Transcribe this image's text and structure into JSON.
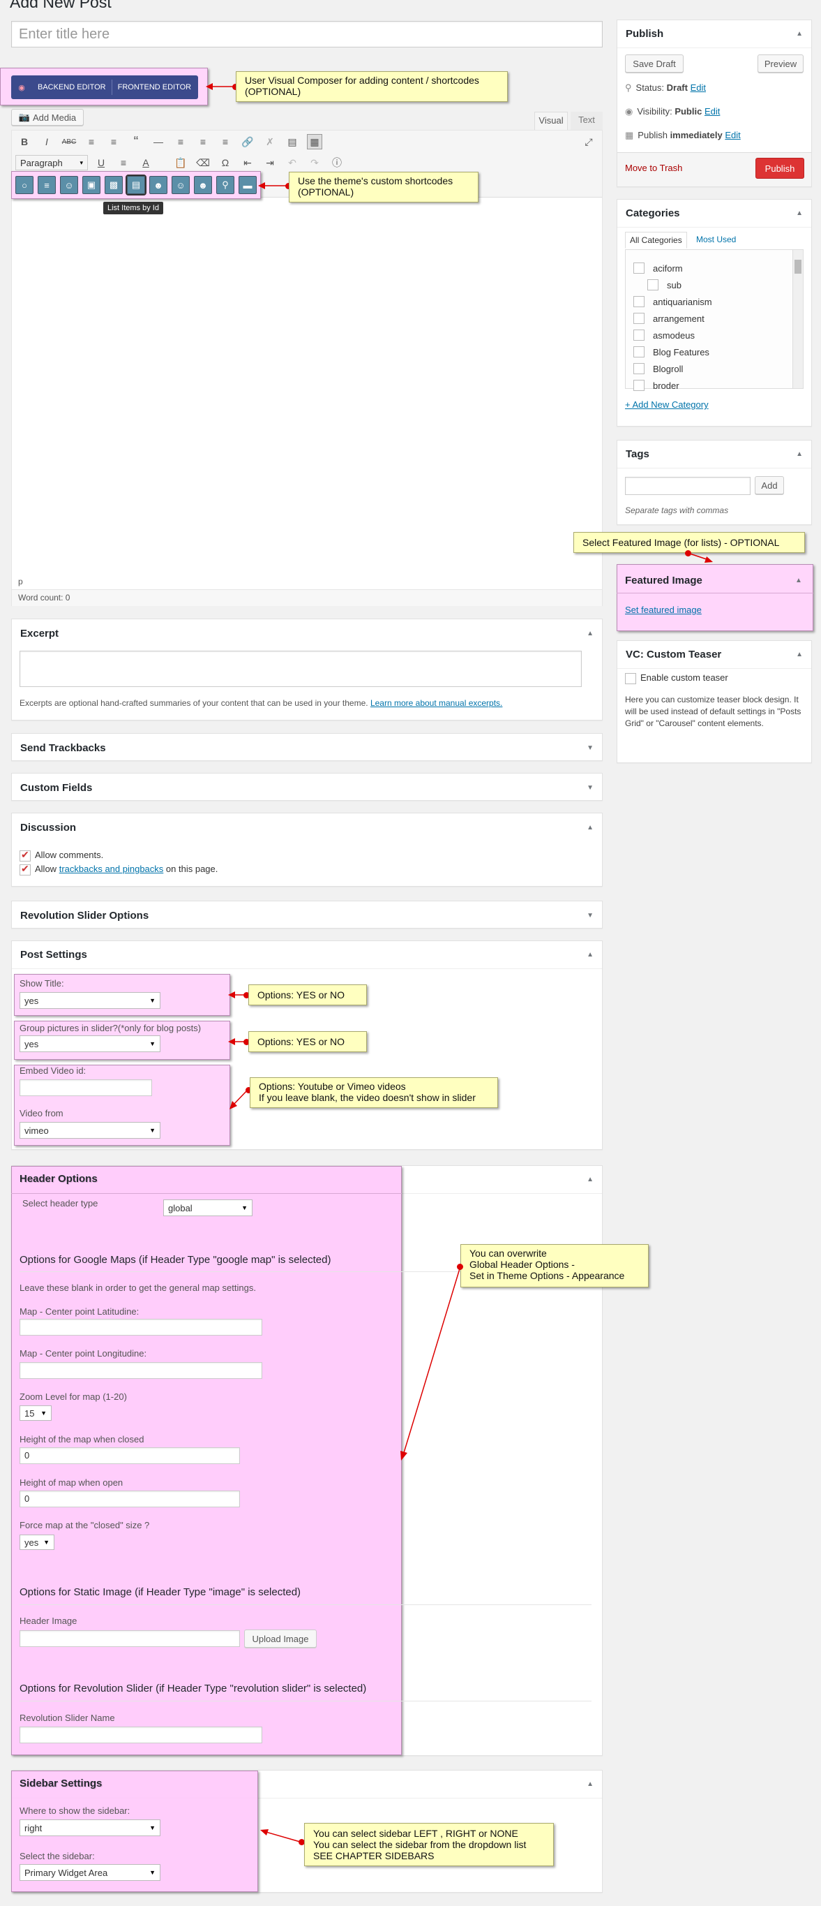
{
  "page": {
    "heading": "Add New Post",
    "title_placeholder": "Enter title here"
  },
  "vc": {
    "backend": "BACKEND EDITOR",
    "frontend": "FRONTEND EDITOR"
  },
  "editor": {
    "add_media": "Add Media",
    "tab_visual": "Visual",
    "tab_text": "Text",
    "paragraph": "Paragraph",
    "tooltip": "List Items by Id",
    "path": "p",
    "word_count": "Word count: 0"
  },
  "notes": {
    "vc": "User Visual Composer for adding content / shortcodes\n(OPTIONAL)",
    "shortcodes": "Use the theme's custom shortcodes\n(OPTIONAL)",
    "featured": "Select Featured Image (for lists) - OPTIONAL",
    "show_title": "Options: YES or NO",
    "group": "Options: YES or NO",
    "video": "Options: Youtube or Vimeo videos\nIf you leave blank, the video doesn't show in slider",
    "header": "You can overwrite\nGlobal Header Options -\nSet in Theme Options - Appearance",
    "sidebar": "You can select sidebar LEFT , RIGHT or NONE\nYou can select the sidebar from the dropdown list\nSEE CHAPTER SIDEBARS"
  },
  "publish": {
    "title": "Publish",
    "save_draft": "Save Draft",
    "preview": "Preview",
    "status_label": "Status:",
    "status_value": "Draft",
    "visibility_label": "Visibility:",
    "visibility_value": "Public",
    "publish_label": "Publish",
    "publish_value": "immediately",
    "edit": "Edit",
    "trash": "Move to Trash",
    "publish_btn": "Publish"
  },
  "categories": {
    "title": "Categories",
    "tab_all": "All Categories",
    "tab_used": "Most Used",
    "items": [
      "aciform",
      "sub",
      "antiquarianism",
      "arrangement",
      "asmodeus",
      "Blog Features",
      "Blogroll",
      "broder"
    ],
    "add_new": "+ Add New Category"
  },
  "tags": {
    "title": "Tags",
    "add": "Add",
    "hint": "Separate tags with commas"
  },
  "featured": {
    "title": "Featured Image",
    "link": "Set featured image"
  },
  "teaser": {
    "title": "VC: Custom Teaser",
    "checkbox": "Enable custom teaser",
    "desc": "Here you can customize teaser block design. It will be used instead of default settings in \"Posts Grid\" or \"Carousel\" content elements."
  },
  "excerpt": {
    "title": "Excerpt",
    "desc": "Excerpts are optional hand-crafted summaries of your content that can be used in your theme.",
    "link": "Learn more about manual excerpts."
  },
  "trackbacks": {
    "title": "Send Trackbacks"
  },
  "custom_fields": {
    "title": "Custom Fields"
  },
  "discussion": {
    "title": "Discussion",
    "allow_comments": "Allow comments.",
    "allow_pre": "Allow",
    "allow_link": "trackbacks and pingbacks",
    "allow_post": "on this page."
  },
  "revslider": {
    "title": "Revolution Slider Options"
  },
  "post_settings": {
    "title": "Post Settings",
    "show_title": "Show Title:",
    "show_title_val": "yes",
    "group": "Group pictures in slider?(*only for blog posts)",
    "group_val": "yes",
    "embed": "Embed Video id:",
    "video_from": "Video from",
    "video_from_val": "vimeo"
  },
  "header": {
    "title": "Header Options",
    "select_type": "Select header type",
    "select_type_val": "global",
    "gmaps_title": "Options for Google Maps (if Header Type \"google map\" is selected)",
    "gmaps_hint": "Leave these blank in order to get the general map settings.",
    "lat": "Map - Center point Latitudine:",
    "lng": "Map - Center point Longitudine:",
    "zoom": "Zoom Level for map (1-20)",
    "zoom_val": "15",
    "h_closed": "Height of the map when closed",
    "h_closed_val": "0",
    "h_open": "Height of map when open",
    "h_open_val": "0",
    "force": "Force map at the \"closed\" size ?",
    "force_val": "yes",
    "static_title": "Options for Static Image (if Header Type \"image\" is selected)",
    "header_image": "Header Image",
    "upload": "Upload Image",
    "rev_title": "Options for Revolution Slider (if Header Type \"revolution slider\" is selected)",
    "rev_name": "Revolution Slider Name"
  },
  "sidebar": {
    "title": "Sidebar Settings",
    "where": "Where to show the sidebar:",
    "where_val": "right",
    "select": "Select the sidebar:",
    "select_val": "Primary Widget Area"
  }
}
